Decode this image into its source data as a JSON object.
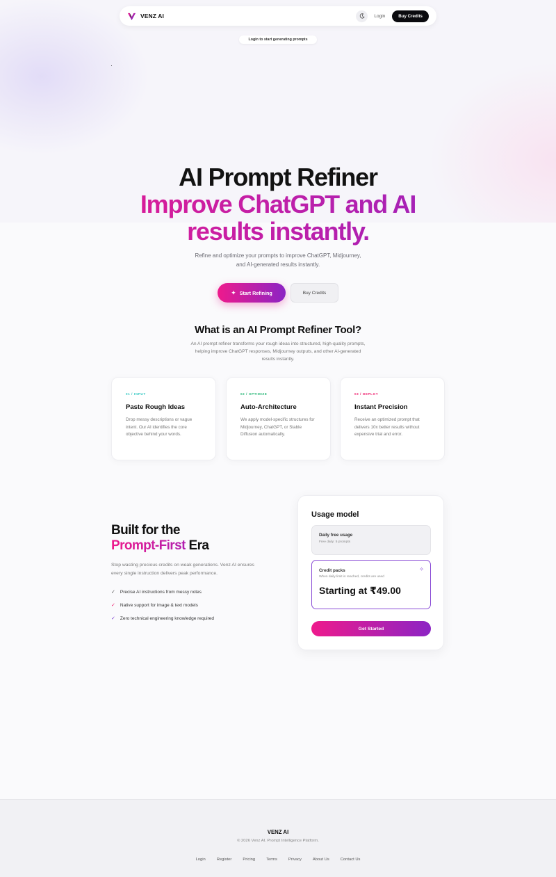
{
  "nav": {
    "brand": "VENZ AI",
    "login": "Login",
    "buy_credits": "Buy Credits",
    "theme_icon": "moon-icon"
  },
  "login_notice": "Login to start generating prompts",
  "hero": {
    "title_line1": "AI Prompt Refiner",
    "title_line2": "Improve ChatGPT and AI",
    "title_line3": "results instantly.",
    "subtitle_line1": "Refine and optimize your prompts to improve ChatGPT, Midjourney,",
    "subtitle_line2": "and AI-generated results instantly.",
    "start_button": "Start Refining",
    "buy_button": "Buy Credits"
  },
  "what_is": {
    "title": "What is an AI Prompt Refiner Tool?",
    "description": "An AI prompt refiner transforms your rough ideas into structured, high-quality prompts, helping improve ChatGPT responses, Midjourney outputs, and other AI-generated results instantly."
  },
  "steps": [
    {
      "step": "01 / INPUT",
      "title": "Paste Rough Ideas",
      "description": "Drop messy descriptions or vague intent. Our AI identifies the core objective behind your words.",
      "color": "#2cc6c0"
    },
    {
      "step": "02 / OPTIMIZE",
      "title": "Auto-Architecture",
      "description": "We apply model-specific structures for Midjourney, ChatGPT, or Stable Diffusion automatically.",
      "color": "#22b573"
    },
    {
      "step": "03 / DEPLOY",
      "title": "Instant Precision",
      "description": "Receive an optimized prompt that delivers 10x better results without expensive trial and error.",
      "color": "#ee1a6a"
    }
  ],
  "built": {
    "title_line1": "Built for the",
    "title_highlight": "Prompt-First",
    "title_rest": " Era",
    "description": "Stop wasting precious credits on weak generations. Venz AI ensures every single instruction delivers peak performance.",
    "features": [
      "Precise AI instructions from messy notes",
      "Native support for image & text models",
      "Zero technical engineering knowledge required"
    ]
  },
  "usage": {
    "title": "Usage model",
    "free_title": "Daily free usage",
    "free_sub": "Free daily: 5 prompts",
    "credit_title": "Credit packs",
    "credit_sub": "When daily limit is reached, credits are used",
    "credit_price": "Starting at ₹49.00",
    "cta": "Get Started"
  },
  "footer": {
    "brand": "VENZ AI",
    "copyright": "© 2026 Venz AI. Prompt Intelligence Platform.",
    "links": [
      "Login",
      "Register",
      "Pricing",
      "Terms",
      "Privacy",
      "About Us",
      "Contact Us"
    ]
  }
}
